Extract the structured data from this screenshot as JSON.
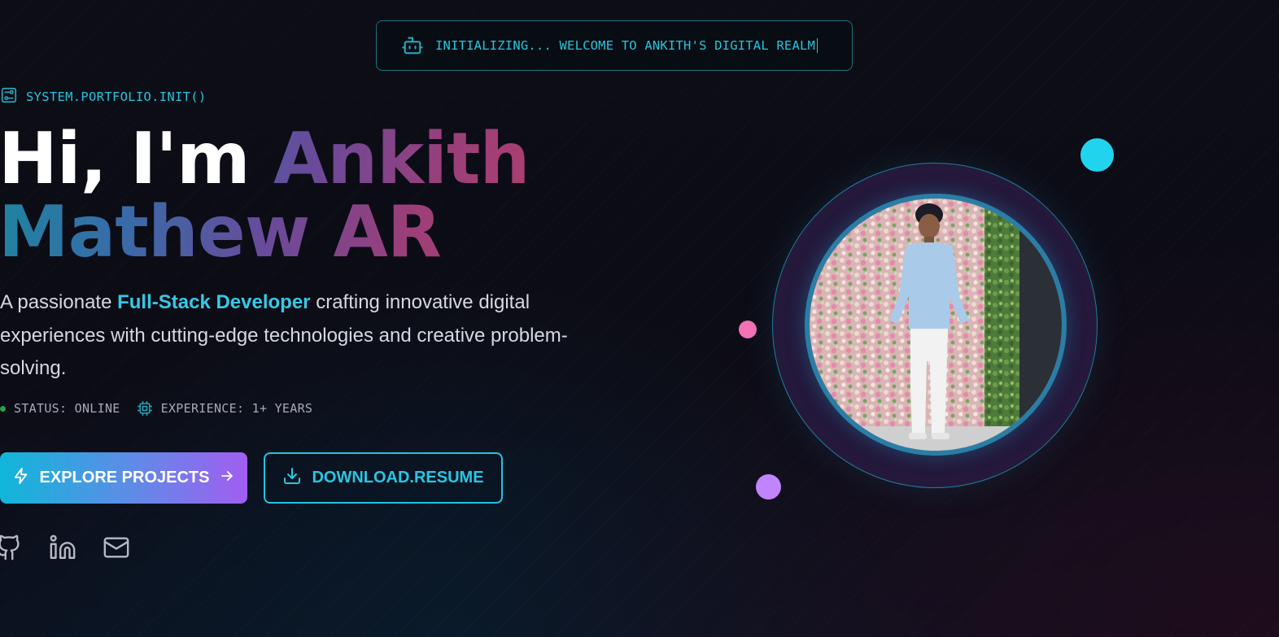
{
  "banner": {
    "text": "INITIALIZING... WELCOME TO ANKITH'S DIGITAL REALM",
    "icon": "robot-icon"
  },
  "hero": {
    "system_tag": "SYSTEM.PORTFOLIO.INIT()",
    "system_icon": "settings-sliders-icon",
    "greeting": "Hi, I'm",
    "name_line1": "Ankith",
    "name_line2": "Mathew AR",
    "description_prefix": "A passionate",
    "description_highlight": "Full-Stack Developer",
    "description_suffix": "crafting innovative digital experiences with cutting-edge technologies and creative problem-solving.",
    "status_label": "STATUS: ONLINE",
    "experience_label": "EXPERIENCE: 1+ YEARS"
  },
  "actions": {
    "explore_label": "EXPLORE PROJECTS",
    "resume_label": "DOWNLOAD.RESUME"
  },
  "socials": [
    {
      "name": "GitHub",
      "icon": "github-icon"
    },
    {
      "name": "LinkedIn",
      "icon": "linkedin-icon"
    },
    {
      "name": "Email",
      "icon": "mail-icon"
    }
  ],
  "portrait": {
    "subject_icon": "profile-photo"
  },
  "colors": {
    "accent_cyan": "#22d3ee",
    "accent_pink": "#f472b6",
    "accent_purple": "#c084fc",
    "status_green": "#22a34a",
    "gradient_start": "#0fb7d9",
    "gradient_end": "#a15ef0"
  }
}
